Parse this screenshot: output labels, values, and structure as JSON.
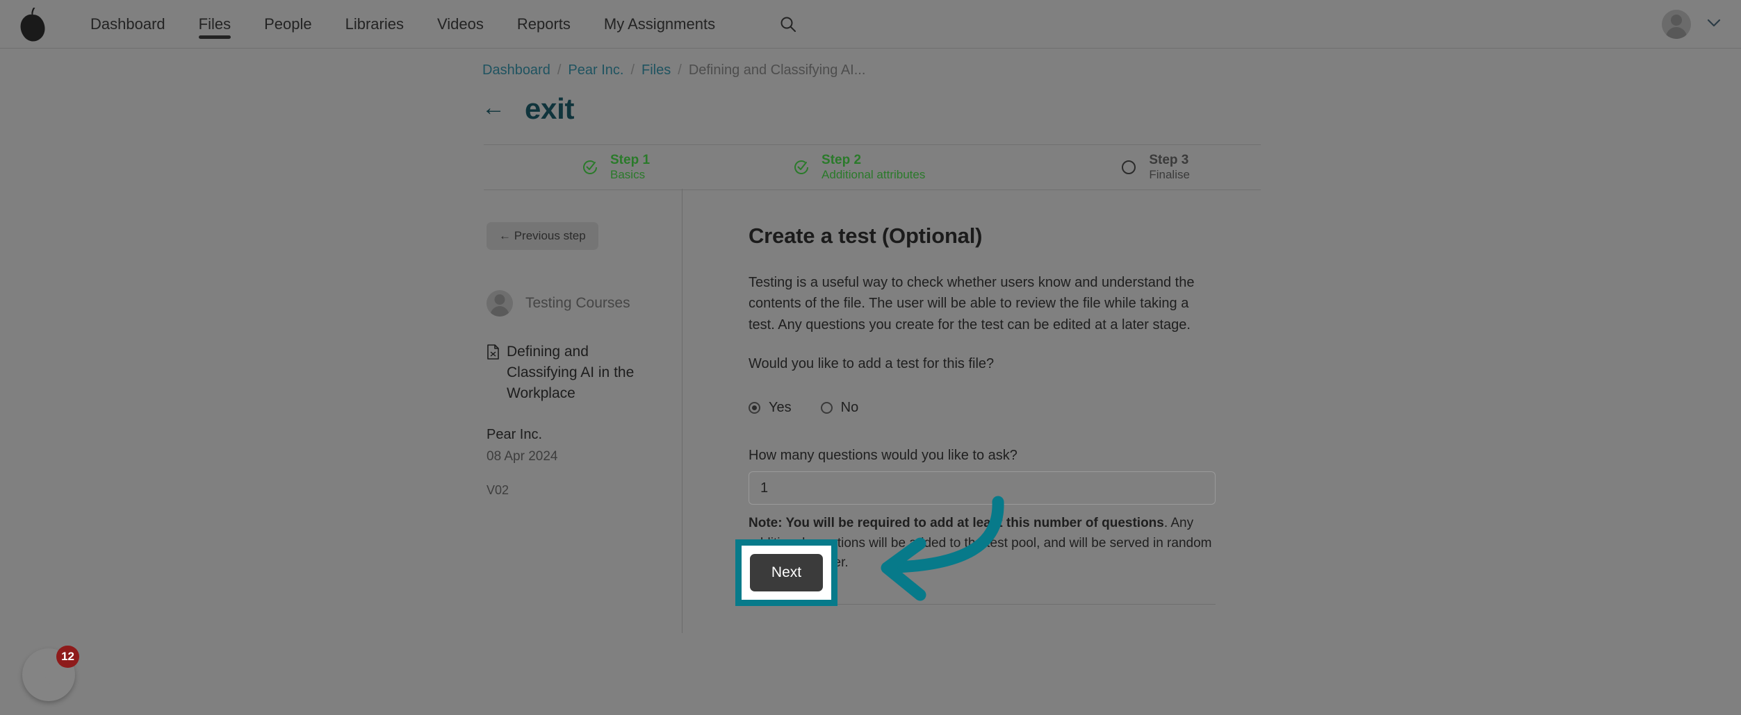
{
  "brand": {
    "logo_icon": "pear-logo-icon",
    "accent_teal": "#077a8a",
    "heading_teal": "#10343c",
    "step_done_green": "#2a7a2a",
    "badge_red": "#8e1b1b"
  },
  "topnav": {
    "items": [
      {
        "label": "Dashboard",
        "active": false
      },
      {
        "label": "Files",
        "active": true
      },
      {
        "label": "People",
        "active": false
      },
      {
        "label": "Libraries",
        "active": false
      },
      {
        "label": "Videos",
        "active": false
      },
      {
        "label": "Reports",
        "active": false
      },
      {
        "label": "My Assignments",
        "active": false
      }
    ],
    "search_icon": "search-icon",
    "avatar_icon": "user-avatar-icon",
    "chevron_icon": "chevron-down-icon"
  },
  "breadcrumb": {
    "items": [
      {
        "label": "Dashboard",
        "current": false
      },
      {
        "label": "Pear Inc.",
        "current": false
      },
      {
        "label": "Files",
        "current": false
      },
      {
        "label": "Defining and Classifying AI...",
        "current": true
      }
    ],
    "separator": "/"
  },
  "page": {
    "back_arrow": "←",
    "title": "exit"
  },
  "steps": [
    {
      "title": "Step 1",
      "subtitle": "Basics",
      "state": "done"
    },
    {
      "title": "Step 2",
      "subtitle": "Additional attributes",
      "state": "done"
    },
    {
      "title": "Step 3",
      "subtitle": "Finalise",
      "state": "todo"
    }
  ],
  "sidebar": {
    "previous_step_label": "← Previous step",
    "course_name": "Testing Courses",
    "file_name": "Defining and Classifying AI in the Workplace",
    "file_icon": "document-icon",
    "organisation": "Pear Inc.",
    "date": "08 Apr 2024",
    "version": "V02"
  },
  "form": {
    "title": "Create a test (Optional)",
    "intro": "Testing is a useful way to check whether users know and understand the contents of the file. The user will be able to review the file while taking a test. Any questions you create for the test can be edited at a later stage.",
    "question": "Would you like to add a test for this file?",
    "radio_yes": "Yes",
    "radio_no": "No",
    "selected": "Yes",
    "count_label": "How many questions would you like to ask?",
    "count_value": "1",
    "count_placeholder": "1",
    "note_bold": "Note: You will be required to add at least this number of questions",
    "note_rest": ". Any additional questions will be added to the test pool, and will be served in random order to the user.",
    "next_label": "Next"
  },
  "help_widget": {
    "icon": "help-widget-icon",
    "badge_count": "12"
  }
}
